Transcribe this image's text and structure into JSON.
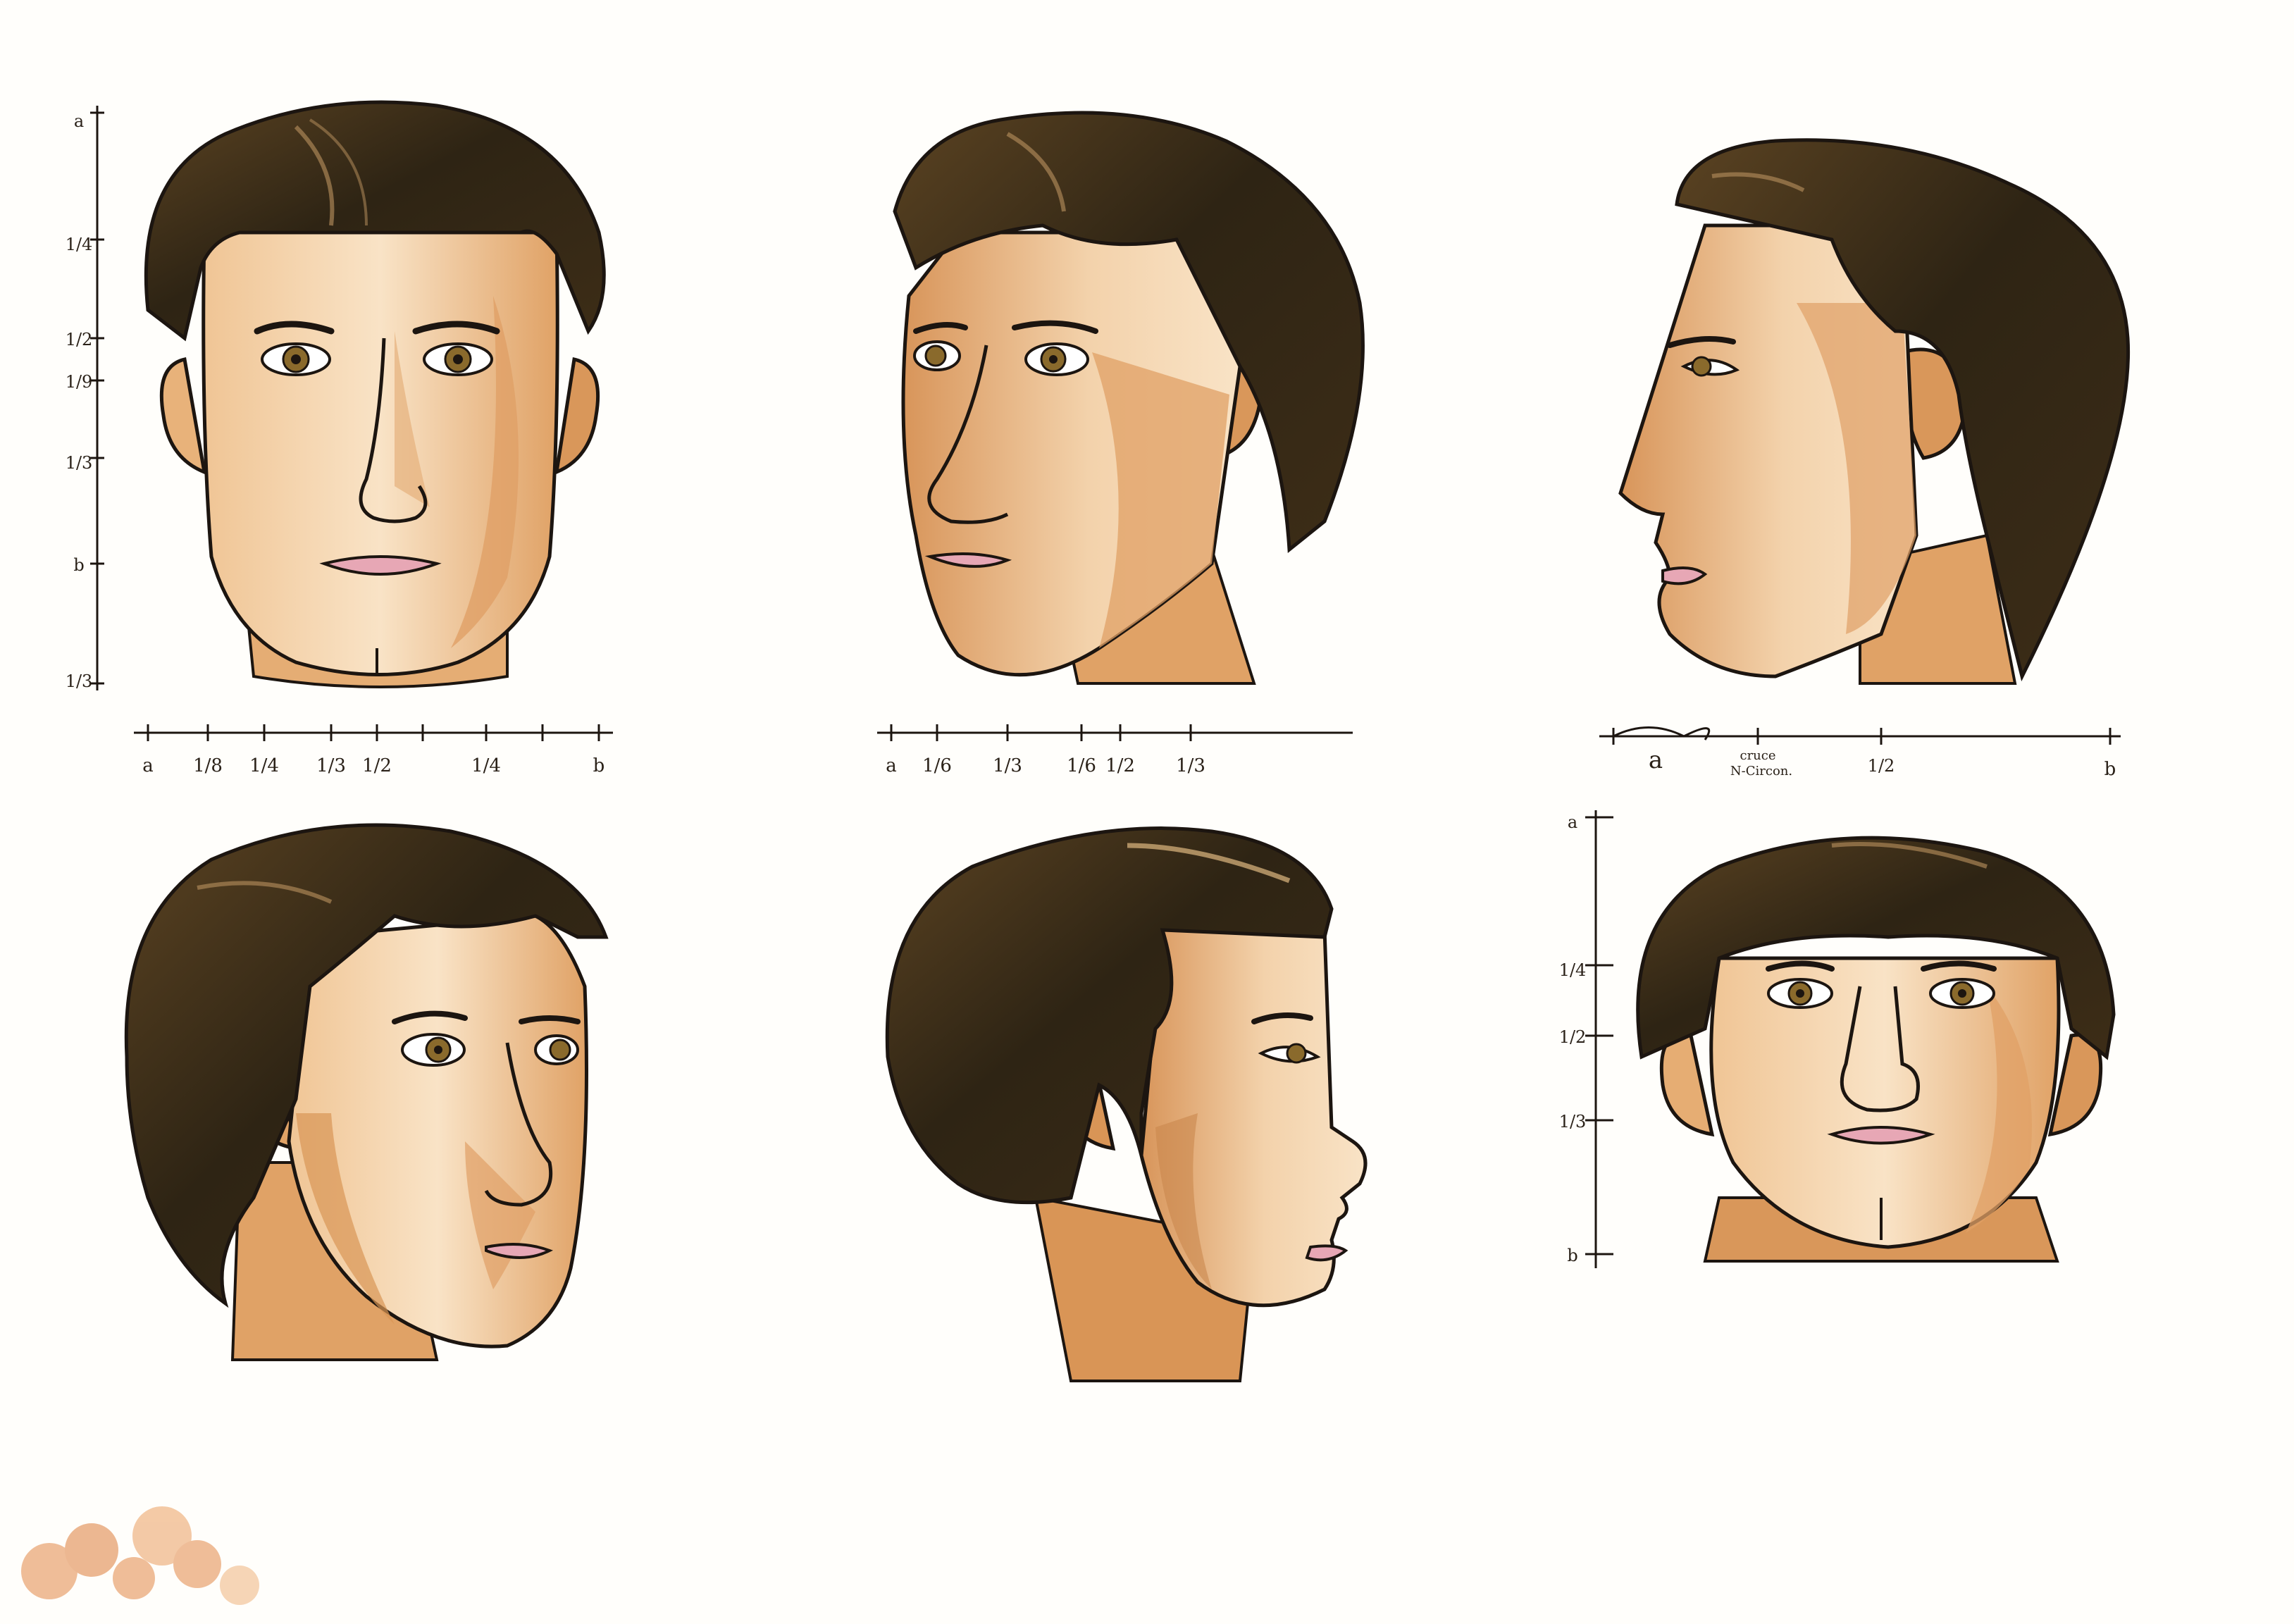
{
  "colors": {
    "hair": "#2e2414",
    "hair_highlight": "#8a6a3a",
    "skin_light": "#f9e3c6",
    "skin_mid": "#eebf8c",
    "skin_shadow": "#d18a4b",
    "lips": "#e7a7b5",
    "iris": "#8a6a2c",
    "ink": "#1c1510",
    "paper": "#fffefb",
    "stain": "#eaa877"
  },
  "rulers": {
    "front_vertical": [
      "a",
      "1/4",
      "1/2",
      "1/9",
      "1/3",
      "b",
      "1/3"
    ],
    "front_horizontal": [
      "a",
      "1/8",
      "1/4",
      "1/3",
      "1/2",
      "1/4",
      "b"
    ],
    "three_quarter_horizontal": [
      "a",
      "1/6",
      "1/3",
      "1/6",
      "1/2",
      "1/3"
    ],
    "profile_horizontal": {
      "left": "a",
      "middle_top": "cruce",
      "middle_bottom": "N-Circon.",
      "half": "1/2",
      "right": "b"
    },
    "low_angle_vertical": [
      "a",
      "1/4",
      "1/2",
      "1/3",
      "b"
    ]
  },
  "views": [
    {
      "id": "front",
      "icon": "head-front-icon"
    },
    {
      "id": "three-quarter-left",
      "icon": "head-three-quarter-icon"
    },
    {
      "id": "profile-left",
      "icon": "head-profile-icon"
    },
    {
      "id": "three-quarter-right",
      "icon": "head-three-quarter-right-icon"
    },
    {
      "id": "profile-right",
      "icon": "head-profile-right-icon"
    },
    {
      "id": "low-angle",
      "icon": "head-low-angle-icon"
    }
  ]
}
